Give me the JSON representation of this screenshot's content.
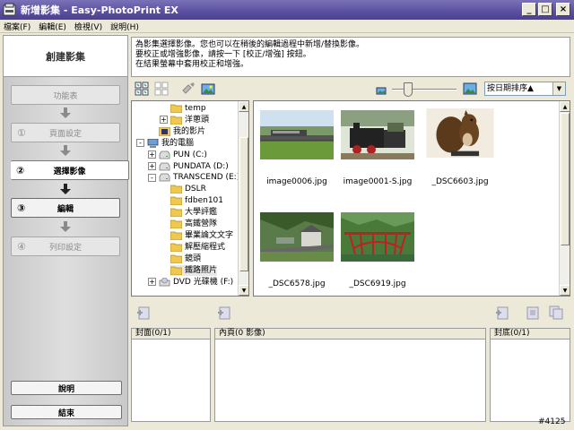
{
  "window": {
    "title": "新增影集 - Easy-PhotoPrint EX"
  },
  "menu": [
    "檔案(F)",
    "編輯(E)",
    "檢視(V)",
    "說明(H)"
  ],
  "left": {
    "title": "創建影集",
    "steps": [
      {
        "num": "",
        "label": "功能表"
      },
      {
        "num": "①",
        "label": "頁面設定"
      },
      {
        "num": "②",
        "label": "選擇影像"
      },
      {
        "num": "③",
        "label": "編輯"
      },
      {
        "num": "④",
        "label": "列印設定"
      }
    ],
    "help_button": "說明",
    "exit_button": "結束"
  },
  "instructions": [
    "為影集選擇影像。您也可以在稍後的編輯過程中新增/替換影像。",
    "要校正或增強影像，請按一下 [校正/增強] 按鈕。",
    "在結果螢幕中套用校正和增強。"
  ],
  "sort": {
    "selected": "按日期排序▲"
  },
  "tree": [
    {
      "label": "temp",
      "type": "folder",
      "indent": 2
    },
    {
      "label": "洋蔥頭",
      "type": "folder",
      "indent": 2,
      "pm": "+"
    },
    {
      "label": "我的影片",
      "type": "film",
      "indent": 1
    },
    {
      "label": "我的電腦",
      "type": "computer",
      "indent": 0,
      "pm": "-"
    },
    {
      "label": "PUN (C:)",
      "type": "drive",
      "indent": 1,
      "pm": "+"
    },
    {
      "label": "PUNDATA (D:)",
      "type": "drive",
      "indent": 1,
      "pm": "+"
    },
    {
      "label": "TRANSCEND (E:)",
      "type": "drive",
      "indent": 1,
      "pm": "-"
    },
    {
      "label": "DSLR",
      "type": "folder",
      "indent": 2
    },
    {
      "label": "fdben101",
      "type": "folder",
      "indent": 2
    },
    {
      "label": "大學評鑑",
      "type": "folder",
      "indent": 2
    },
    {
      "label": "高鐵營隊",
      "type": "folder",
      "indent": 2
    },
    {
      "label": "畢業論文文字",
      "type": "folder",
      "indent": 2
    },
    {
      "label": "解壓縮程式",
      "type": "folder",
      "indent": 2
    },
    {
      "label": "鏡頭",
      "type": "folder",
      "indent": 2
    },
    {
      "label": "鐵路照片",
      "type": "folder",
      "indent": 2,
      "selected": true
    },
    {
      "label": "DVD 光碟機 (F:)",
      "type": "dvd",
      "indent": 1,
      "pm": "+"
    }
  ],
  "images": [
    {
      "name": "image0006.jpg"
    },
    {
      "name": "image0001-S.jpg"
    },
    {
      "name": "_DSC6603.jpg"
    },
    {
      "name": "_DSC6578.jpg"
    },
    {
      "name": "_DSC6919.jpg"
    }
  ],
  "columns": {
    "cover": "封面(0/1)",
    "inner": "內頁(0 影像)",
    "back": "封底(0/1)"
  },
  "watermark": "#4125"
}
